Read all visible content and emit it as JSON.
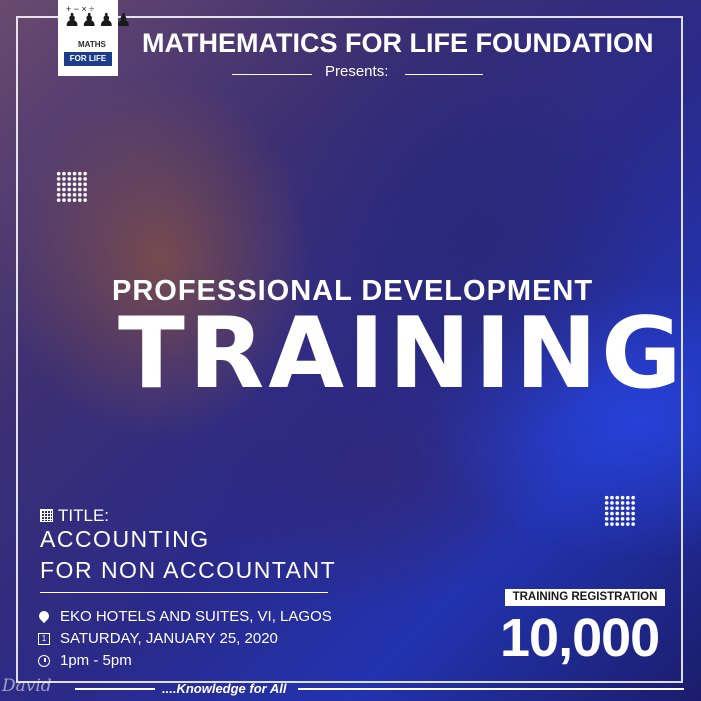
{
  "header": {
    "logo": {
      "text": "MATHS",
      "bar_text": "FOR LIFE",
      "symbols": "+ − × ÷"
    },
    "org_name": "MATHEMATICS FOR LIFE FOUNDATION",
    "presents": "Presents:"
  },
  "hero": {
    "subtitle": "PROFESSIONAL DEVELOPMENT",
    "title": "TRAINING"
  },
  "course": {
    "label": "TITLE:",
    "line1": "ACCOUNTING",
    "line2": "FOR NON ACCOUNTANT"
  },
  "details": {
    "location": "EKO HOTELS AND SUITES, VI, LAGOS",
    "date": "SATURDAY, JANUARY 25, 2020",
    "time": "1pm - 5pm",
    "calendar_glyph": "1"
  },
  "registration": {
    "label": "TRAINING REGISTRATION",
    "price": "10,000"
  },
  "footer": {
    "tagline": "....Knowledge for All",
    "signature": "David"
  },
  "colors": {
    "accent_blue": "#2233b0",
    "logo_bar": "#1d3c8a",
    "text": "#ffffff"
  }
}
